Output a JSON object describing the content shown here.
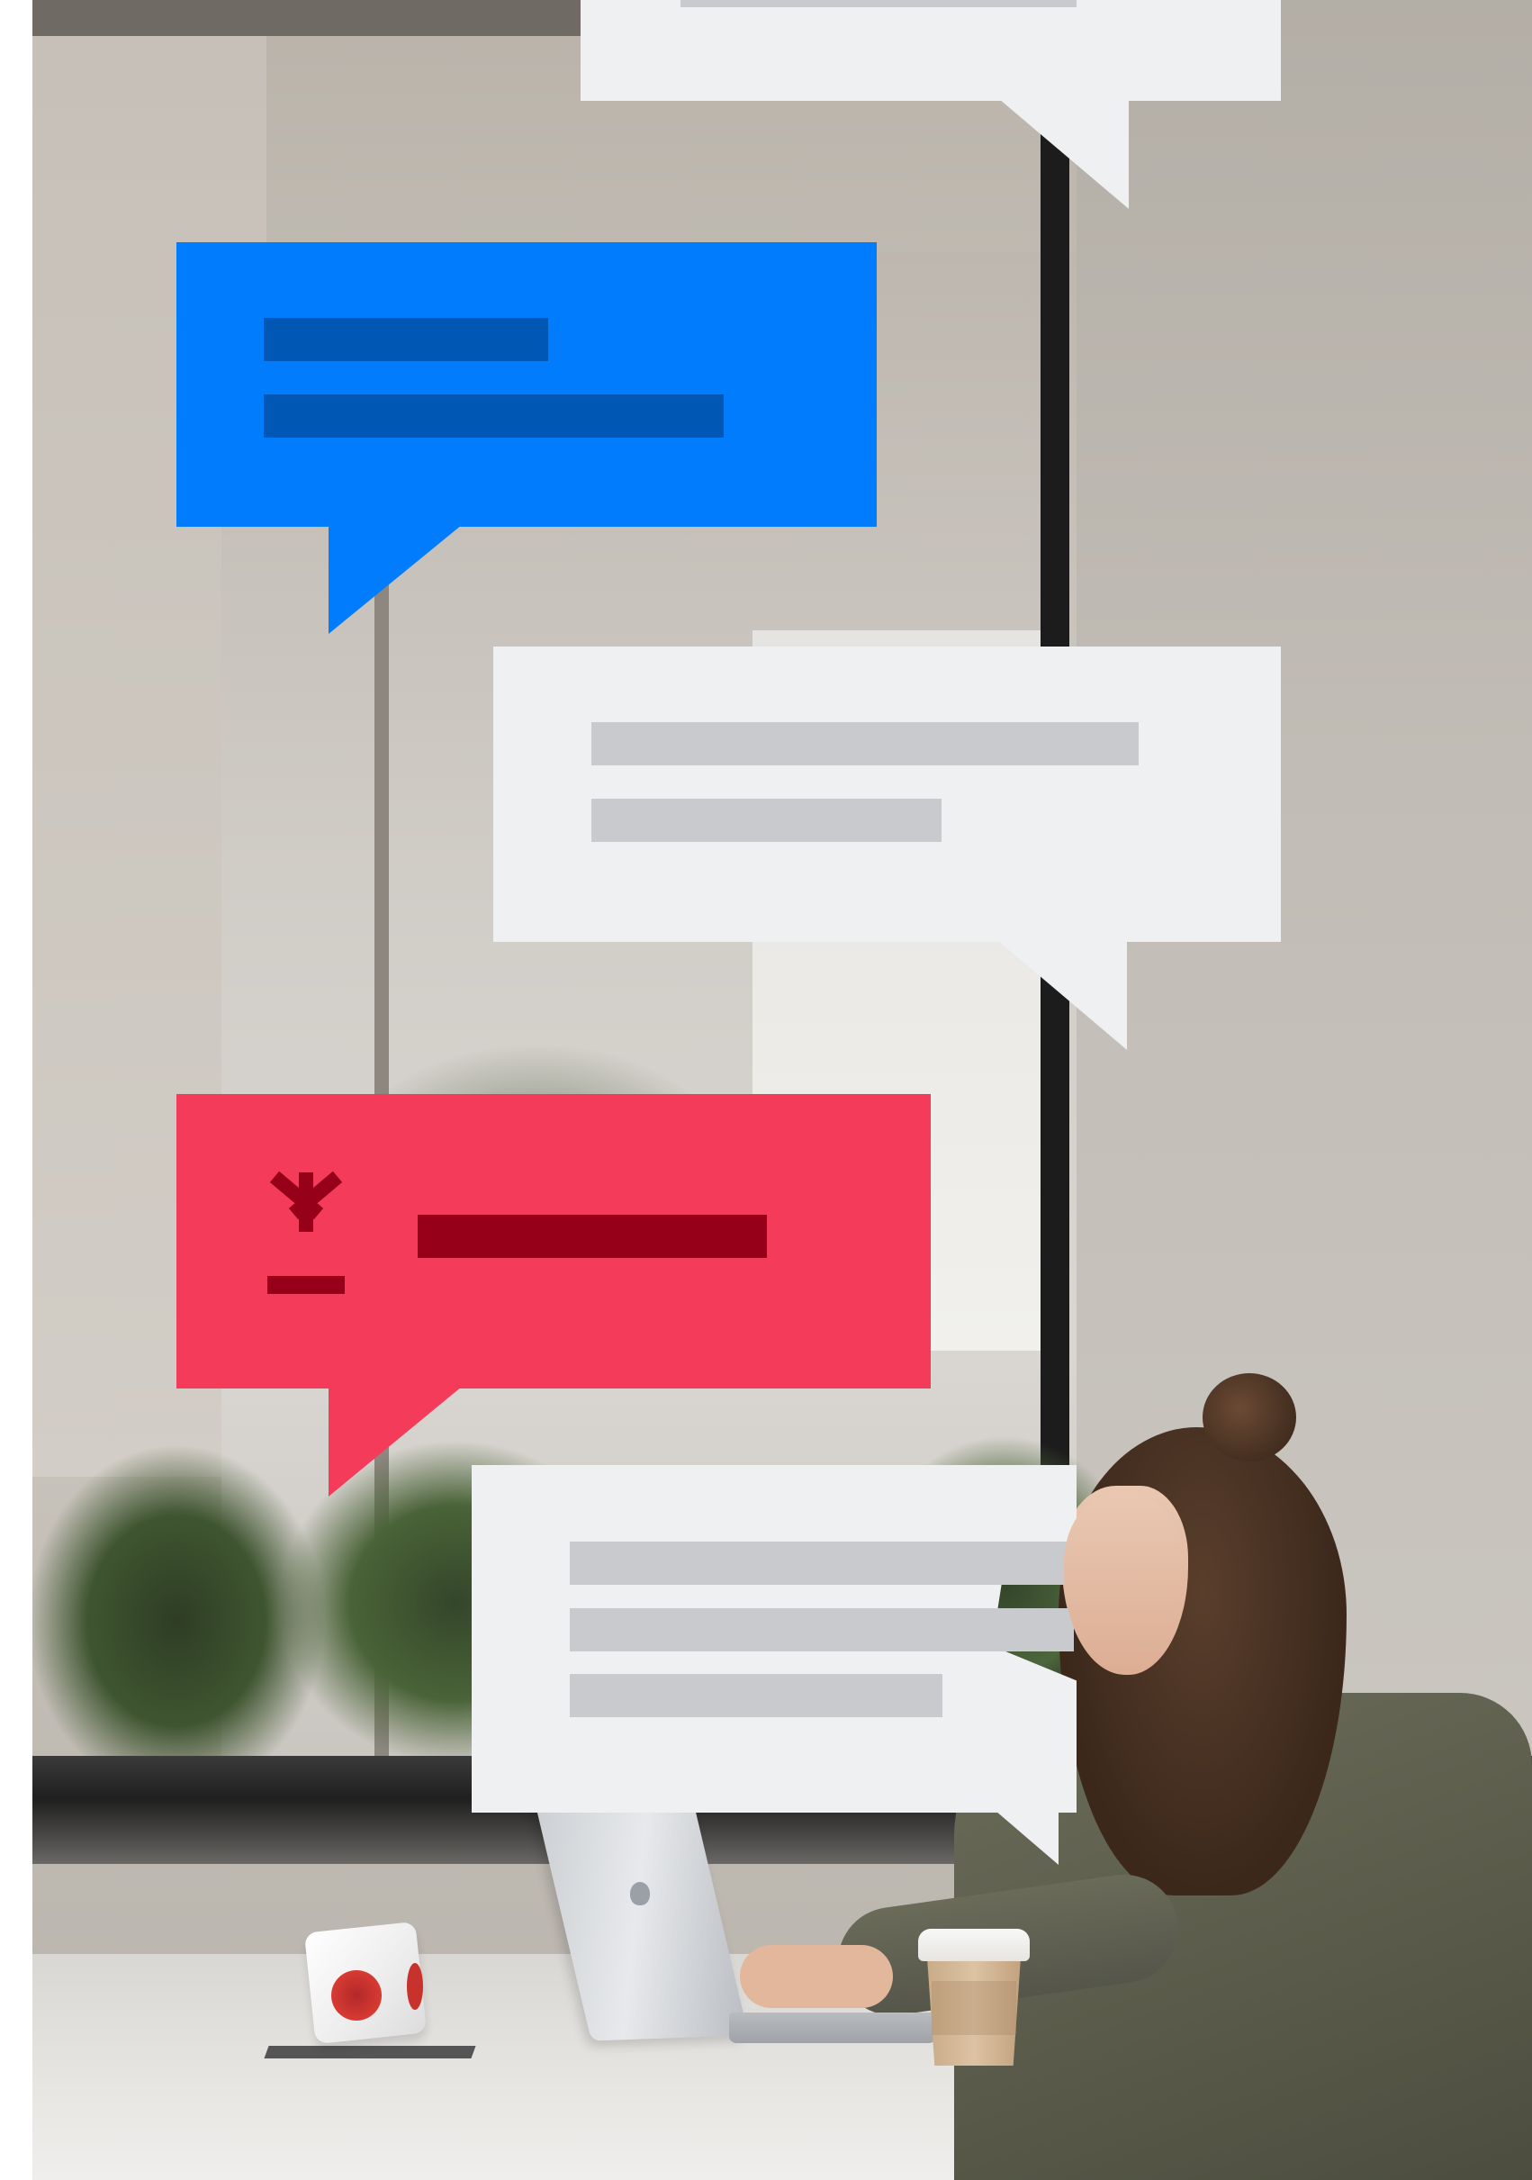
{
  "scene": {
    "photo": "woman-working-on-laptop-in-office",
    "background_color": "#ffffff"
  },
  "bubbles": [
    {
      "id": "top-light",
      "color": "#eff0f2",
      "bar_color": "#c9cace",
      "bars": 1,
      "tail": "bottom-right"
    },
    {
      "id": "blue",
      "color": "#007cfd",
      "bar_color": "#0058b4",
      "bars": 2,
      "tail": "bottom-left"
    },
    {
      "id": "light-1",
      "color": "#eff0f2",
      "bar_color": "#c9cace",
      "bars": 2,
      "tail": "bottom-right"
    },
    {
      "id": "red",
      "color": "#f43c5a",
      "bar_color": "#960018",
      "bars": 1,
      "icon": "download-icon",
      "tail": "bottom-left"
    },
    {
      "id": "light-2",
      "color": "#eff0f2",
      "bar_color": "#c9cace",
      "bars": 3,
      "tail": "bottom-right"
    }
  ]
}
